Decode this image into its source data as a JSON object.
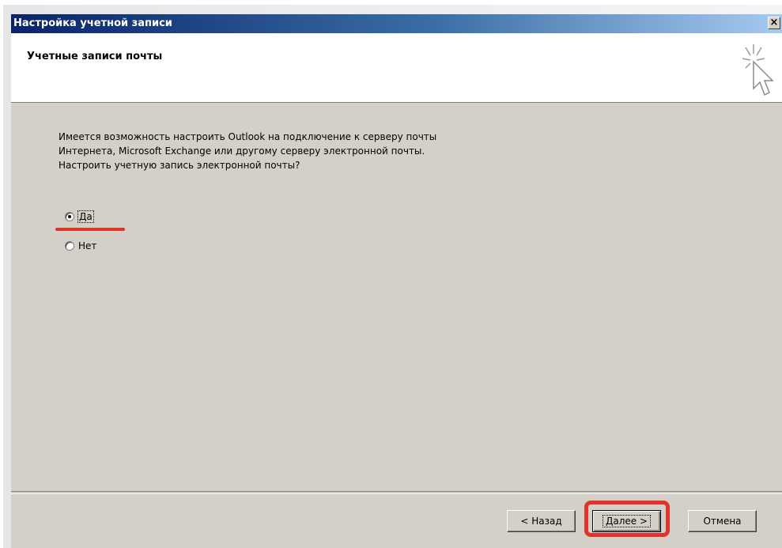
{
  "window": {
    "title": "Настройка учетной записи",
    "close_glyph": "×"
  },
  "header": {
    "title": "Учетные записи почты",
    "icon": "cursor-sparkle-icon"
  },
  "description": {
    "lines": [
      "Имеется возможность настроить Outlook на подключение к серверу почты",
      "Интернета, Microsoft Exchange или другому серверу электронной почты.",
      "Настроить учетную запись электронной почты?"
    ]
  },
  "options": {
    "yes_label": "Да",
    "no_label": "Нет",
    "selected": "yes"
  },
  "buttons": {
    "back_label": "< Назад",
    "next_label": "Далее >",
    "cancel_label": "Отмена"
  },
  "colors": {
    "title_bar_start": "#0a246a",
    "title_bar_end": "#a6caf0",
    "dialog_bg": "#d4d0c8",
    "highlight_red": "#e0342b"
  }
}
